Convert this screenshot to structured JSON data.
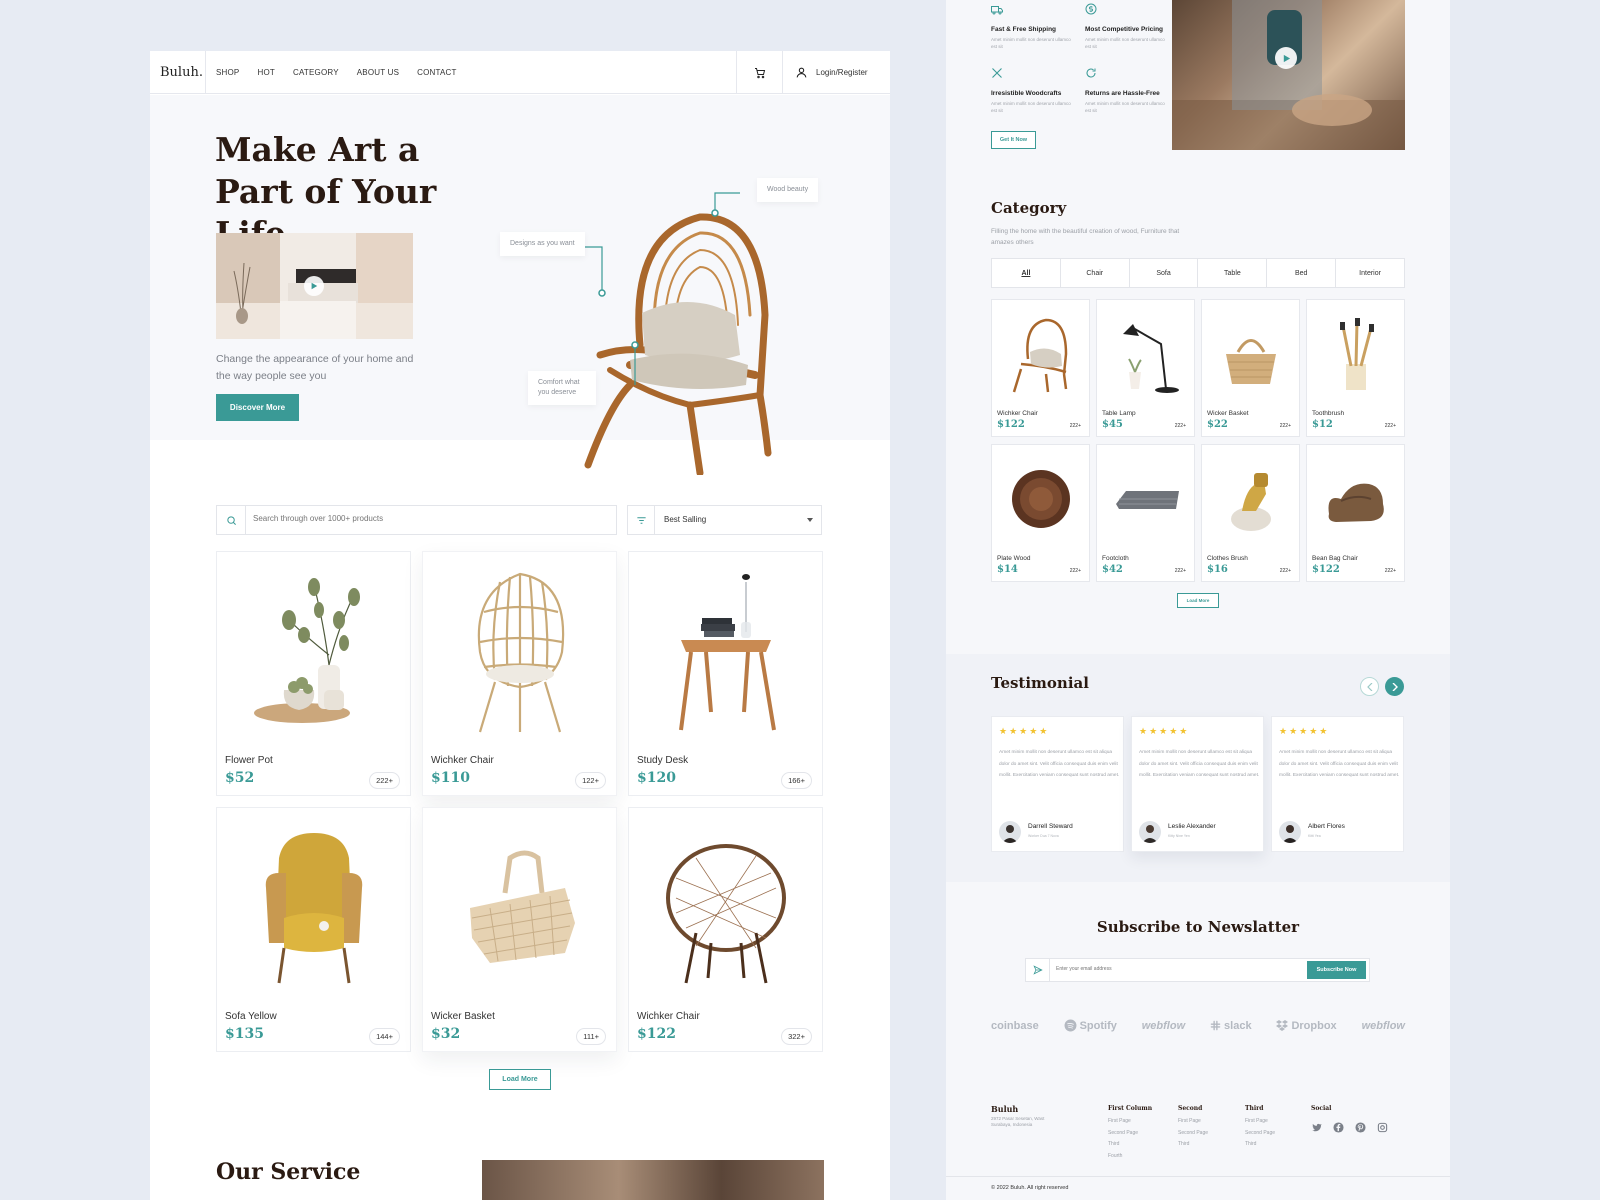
{
  "colors": {
    "accent": "#3a9a96",
    "heading": "#2a1a12",
    "star": "#f2c230"
  },
  "nav": {
    "logo": "Buluh.",
    "links": [
      "SHOP",
      "HOT",
      "CATEGORY",
      "ABOUT US",
      "CONTACT"
    ],
    "login_label": "Login/Register"
  },
  "hero": {
    "title": "Make Art a Part of Your Life",
    "description": "Change the appearance of your home and the way people see you",
    "cta_label": "Discover More",
    "callouts": {
      "wood": "Wood beauty",
      "designs": "Designs as you want",
      "comfort": "Comfort what you deserve"
    }
  },
  "search": {
    "placeholder": "Search through over 1000+ products",
    "sort_label": "Best Salling"
  },
  "products": [
    {
      "name": "Flower Pot",
      "price": "$52",
      "count": "222+",
      "icon": "flower-pot"
    },
    {
      "name": "Wichker Chair",
      "price": "$110",
      "count": "122+",
      "icon": "egg-chair"
    },
    {
      "name": "Study Desk",
      "price": "$120",
      "count": "166+",
      "icon": "study-desk"
    },
    {
      "name": "Sofa Yellow",
      "price": "$135",
      "count": "144+",
      "icon": "yellow-sofa"
    },
    {
      "name": "Wicker Basket",
      "price": "$32",
      "count": "111+",
      "icon": "wicker-basket"
    },
    {
      "name": "Wichker Chair",
      "price": "$122",
      "count": "322+",
      "icon": "round-chair"
    }
  ],
  "load_more_label": "Load More",
  "service_title": "Our Service",
  "features": [
    {
      "title": "Fast & Free Shipping",
      "desc": "Amet minim mollit non deserunt ullamco est sit",
      "icon": "truck-icon"
    },
    {
      "title": "Most Competitive Pricing",
      "desc": "Amet minim mollit non deserunt ullamco est sit",
      "icon": "dollar-icon"
    },
    {
      "title": "Irresistible Woodcrafts",
      "desc": "Amet minim mollit non deserunt ullamco est sit",
      "icon": "tools-icon"
    },
    {
      "title": "Returns are Hassle-Free",
      "desc": "Amet minim mollit non deserunt ullamco est sit",
      "icon": "return-icon"
    }
  ],
  "get_it_now_label": "Get It Now",
  "category": {
    "title": "Category",
    "description": "Filling the home with the beautiful creation of wood, Furniture that amazes others",
    "tabs": [
      "All",
      "Chair",
      "Sofa",
      "Table",
      "Bed",
      "Interior"
    ],
    "active_tab": "All",
    "items": [
      {
        "name": "Wichker Chair",
        "price": "$122",
        "count": "222+"
      },
      {
        "name": "Table Lamp",
        "price": "$45",
        "count": "222+"
      },
      {
        "name": "Wicker Basket",
        "price": "$22",
        "count": "222+"
      },
      {
        "name": "Toothbrush",
        "price": "$12",
        "count": "222+"
      },
      {
        "name": "Plate Wood",
        "price": "$14",
        "count": "222+"
      },
      {
        "name": "Footcloth",
        "price": "$42",
        "count": "222+"
      },
      {
        "name": "Clothes Brush",
        "price": "$16",
        "count": "222+"
      },
      {
        "name": "Bean Bag Chair",
        "price": "$122",
        "count": "222+"
      }
    ],
    "load_more_label": "Load More"
  },
  "testimonial": {
    "title": "Testimonial",
    "text": "Amet minim mollit non deserunt ullamco est sit aliqua dolor do amet sint. Velit officia consequat duis enim velit mollit. Exercitation veniam consequat sunt nostrud amet.",
    "stars": "★★★★★",
    "items": [
      {
        "name": "Darrell Steward",
        "role": "Worker Dua 7 Nova"
      },
      {
        "name": "Leslie Alexander",
        "role": "Kitty Nine Yen"
      },
      {
        "name": "Albert Flores",
        "role": "Kitti Yea"
      }
    ]
  },
  "newsletter": {
    "title": "Subscribe to Newslatter",
    "placeholder": "Enter your email address",
    "button_label": "Subscribe Now"
  },
  "brands": [
    "coinbase",
    "Spotify",
    "webflow",
    "slack",
    "Dropbox",
    "webflow"
  ],
  "footer": {
    "brand": "Buluh",
    "address": "2972 Pasar Sesetan, Wast Surabaya, Indonesia",
    "columns": [
      {
        "title": "First Column",
        "links": [
          "First Page",
          "Second Page",
          "Third",
          "Fourth"
        ]
      },
      {
        "title": "Second",
        "links": [
          "First Page",
          "Second Page",
          "Third"
        ]
      },
      {
        "title": "Third",
        "links": [
          "First Page",
          "Second Page",
          "Third"
        ]
      }
    ],
    "social_title": "Social",
    "copyright": "© 2022 Buluh. All right reserved"
  }
}
